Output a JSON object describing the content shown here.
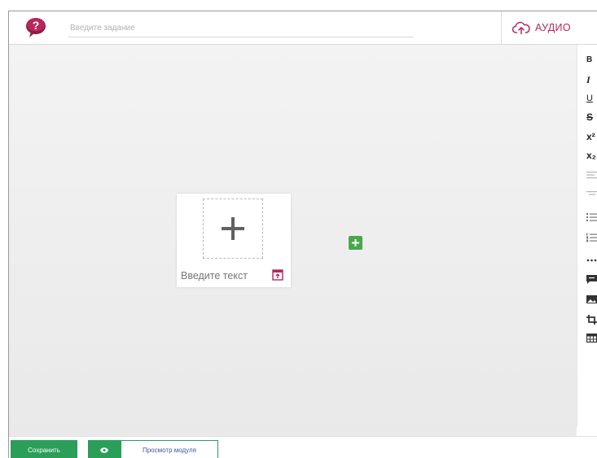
{
  "header": {
    "help_icon": "question-speech-bubble-icon",
    "task_input": {
      "placeholder": "Введите задание",
      "value": ""
    },
    "audio_button": {
      "label": "АУДИО",
      "icon": "cloud-upload-icon"
    }
  },
  "canvas": {
    "text_card": {
      "text": "Введите текст",
      "drop_icon": "plus-icon",
      "upload_icon": "upload-icon"
    },
    "add_block_icon": "plus-icon"
  },
  "toolbar": {
    "bold": "B",
    "italic": "I",
    "underline": "U",
    "strikethrough": "S",
    "superscript": "x²",
    "subscript": "x₂",
    "icons": [
      "align-left-icon",
      "align-center-icon",
      "unordered-list-icon",
      "ordered-list-icon",
      "more-icon",
      "comment-icon",
      "image-icon",
      "crop-icon",
      "table-icon"
    ]
  },
  "footer": {
    "save_label": "Сохранить",
    "eye_icon": "eye-icon",
    "preview_label": "Просмотр модуля"
  },
  "colors": {
    "brand": "#b7275d",
    "green": "#2b9e59",
    "add_green": "#47a84b",
    "link_blue": "#3a56b0"
  }
}
